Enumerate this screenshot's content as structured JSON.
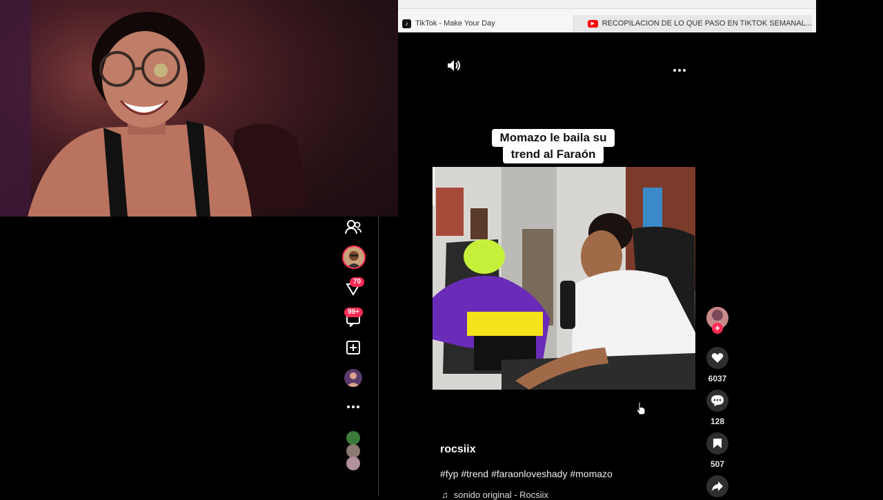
{
  "browser": {
    "tabs": [
      {
        "label": "TikTok - Make Your Day",
        "icon": "tiktok-icon"
      },
      {
        "label": "RECOPILACION DE LO QUE PASO EN TIKTOK SEMANAL...",
        "icon": "youtube-icon"
      }
    ]
  },
  "sidebar": {
    "inbox_badge": "70",
    "messages_badge": "99+",
    "items": [
      "friends-icon",
      "avatar",
      "inbox-icon",
      "messages-icon",
      "upload-icon",
      "profile-avatar",
      "more-icon"
    ]
  },
  "video": {
    "caption_line1": "Momazo le baila su",
    "caption_line2": "trend al Faraón",
    "author": "rocsiix",
    "hashtags": "#fyp #trend #faraonloveshady #momazo",
    "sound": "sonido original - Rocsiix"
  },
  "actions": {
    "likes": "6037",
    "comments": "128",
    "saves": "507"
  },
  "colors": {
    "accent": "#fe2c55",
    "background": "#000000"
  }
}
